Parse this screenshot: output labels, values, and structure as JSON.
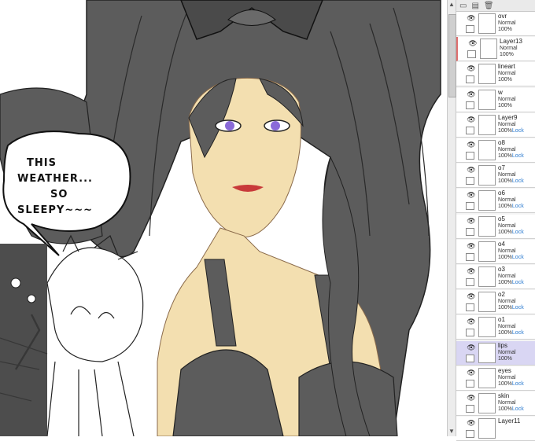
{
  "speech_bubble": {
    "line1": "THIS",
    "line2": "WEATHER...",
    "line3": "SO",
    "line4": "SLEEPY~~~"
  },
  "toolbar": {
    "icons": [
      "new-layer-icon",
      "folder-icon",
      "trash-icon"
    ]
  },
  "layers": [
    {
      "name": "ovr",
      "mode": "Normal",
      "opacity": "100%",
      "lock": ""
    },
    {
      "name": "Layer13",
      "mode": "Normal",
      "opacity": "100%",
      "lock": ""
    },
    {
      "name": "lineart",
      "mode": "Normal",
      "opacity": "100%",
      "lock": ""
    },
    {
      "name": "w",
      "mode": "Normal",
      "opacity": "100%",
      "lock": ""
    },
    {
      "name": "Layer9",
      "mode": "Normal",
      "opacity": "100%",
      "lock": "Lock"
    },
    {
      "name": "o8",
      "mode": "Normal",
      "opacity": "100%",
      "lock": "Lock"
    },
    {
      "name": "o7",
      "mode": "Normal",
      "opacity": "100%",
      "lock": "Lock"
    },
    {
      "name": "o6",
      "mode": "Normal",
      "opacity": "100%",
      "lock": "Lock"
    },
    {
      "name": "o5",
      "mode": "Normal",
      "opacity": "100%",
      "lock": "Lock"
    },
    {
      "name": "o4",
      "mode": "Normal",
      "opacity": "100%",
      "lock": "Lock"
    },
    {
      "name": "o3",
      "mode": "Normal",
      "opacity": "100%",
      "lock": "Lock"
    },
    {
      "name": "o2",
      "mode": "Normal",
      "opacity": "100%",
      "lock": "Lock"
    },
    {
      "name": "o1",
      "mode": "Normal",
      "opacity": "100%",
      "lock": "Lock"
    },
    {
      "name": "lips",
      "mode": "Normal",
      "opacity": "100%",
      "lock": ""
    },
    {
      "name": "eyes",
      "mode": "Normal",
      "opacity": "100%",
      "lock": "Lock"
    },
    {
      "name": "skin",
      "mode": "Normal",
      "opacity": "100%",
      "lock": "Lock"
    },
    {
      "name": "Layer11",
      "mode": "",
      "opacity": "",
      "lock": ""
    }
  ],
  "selected_layer": "lips",
  "colors": {
    "hair": "#5a5a5a",
    "skin": "#f3dfb0",
    "selected": "#d9d6f3"
  }
}
